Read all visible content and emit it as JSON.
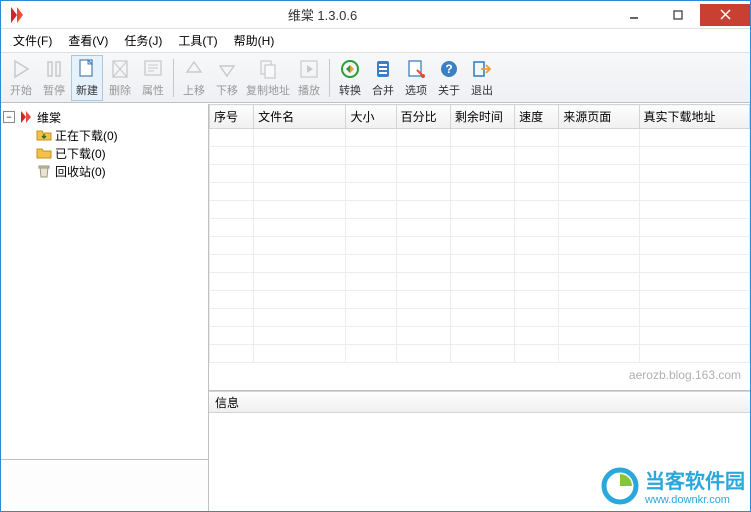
{
  "titlebar": {
    "title": "维棠 1.3.0.6"
  },
  "menu": {
    "file": "文件(F)",
    "view": "查看(V)",
    "task": "任务(J)",
    "tool": "工具(T)",
    "help": "帮助(H)"
  },
  "toolbar": {
    "start": "开始",
    "pause": "暂停",
    "new": "新建",
    "delete": "删除",
    "properties": "属性",
    "moveup": "上移",
    "movedown": "下移",
    "copyaddr": "复制地址",
    "play": "播放",
    "convert": "转换",
    "merge": "合并",
    "options": "选项",
    "about": "关于",
    "exit": "退出"
  },
  "tree": {
    "root": "维棠",
    "downloading": "正在下载(0)",
    "downloaded": "已下载(0)",
    "recycle": "回收站(0)"
  },
  "columns": {
    "index": "序号",
    "filename": "文件名",
    "size": "大小",
    "percent": "百分比",
    "remaining": "剩余时间",
    "speed": "速度",
    "source": "来源页面",
    "realurl": "真实下载地址"
  },
  "info": {
    "header": "信息"
  },
  "watermark": {
    "brand": "当客软件园",
    "url": "www.downkr.com",
    "blog": "aerozb.blog.163.com"
  }
}
